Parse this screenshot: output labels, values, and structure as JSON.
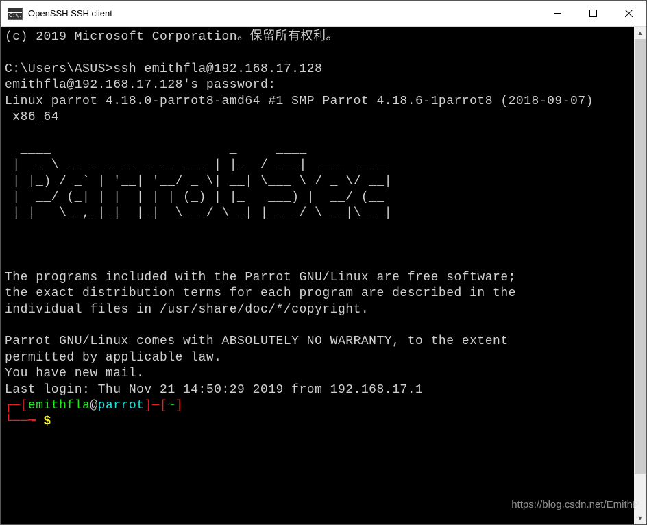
{
  "window": {
    "title": "OpenSSH SSH client",
    "icon_glyph": "C:\\."
  },
  "terminal": {
    "copyright": "(c) 2019 Microsoft Corporation。保留所有权利。",
    "prompt_local": "C:\\Users\\ASUS>",
    "ssh_cmd": "ssh emithfla@192.168.17.128",
    "pw_prompt": "emithfla@192.168.17.128's password:",
    "kernel": "Linux parrot 4.18.0-parrot8-amd64 #1 SMP Parrot 4.18.6-1parrot8 (2018-09-07)\n x86_64",
    "ascii_art": "  ____                       _     ____             \n |  _ \\ __ _ _ __ _ __ ___ | |_  / ___|  ___  ___ \n | |_) / _` | '__| '__/ _ \\| __| \\___ \\ / _ \\/ __|\n |  __/ (_| | |  | | | (_) | |_   ___) |  __/ (__ \n |_|   \\__,_|_|  |_|  \\___/ \\__| |____/ \\___|\\___|",
    "msg_programs": "The programs included with the Parrot GNU/Linux are free software;\nthe exact distribution terms for each program are described in the\nindividual files in /usr/share/doc/*/copyright.",
    "msg_warranty": "Parrot GNU/Linux comes with ABSOLUTELY NO WARRANTY, to the extent\npermitted by applicable law.",
    "msg_mail": "You have new mail.",
    "last_login": "Last login: Thu Nov 21 14:50:29 2019 from 192.168.17.1",
    "ps1": {
      "open_corner": "┌─[",
      "user": "emithfla",
      "at": "@",
      "host": "parrot",
      "close1": "]",
      "dash": "─",
      "open2": "[",
      "path": "~",
      "close2": "]",
      "line2_corner": "└──╼ ",
      "dollar": "$"
    }
  },
  "watermark": "https://blog.csdn.net/EmithP"
}
